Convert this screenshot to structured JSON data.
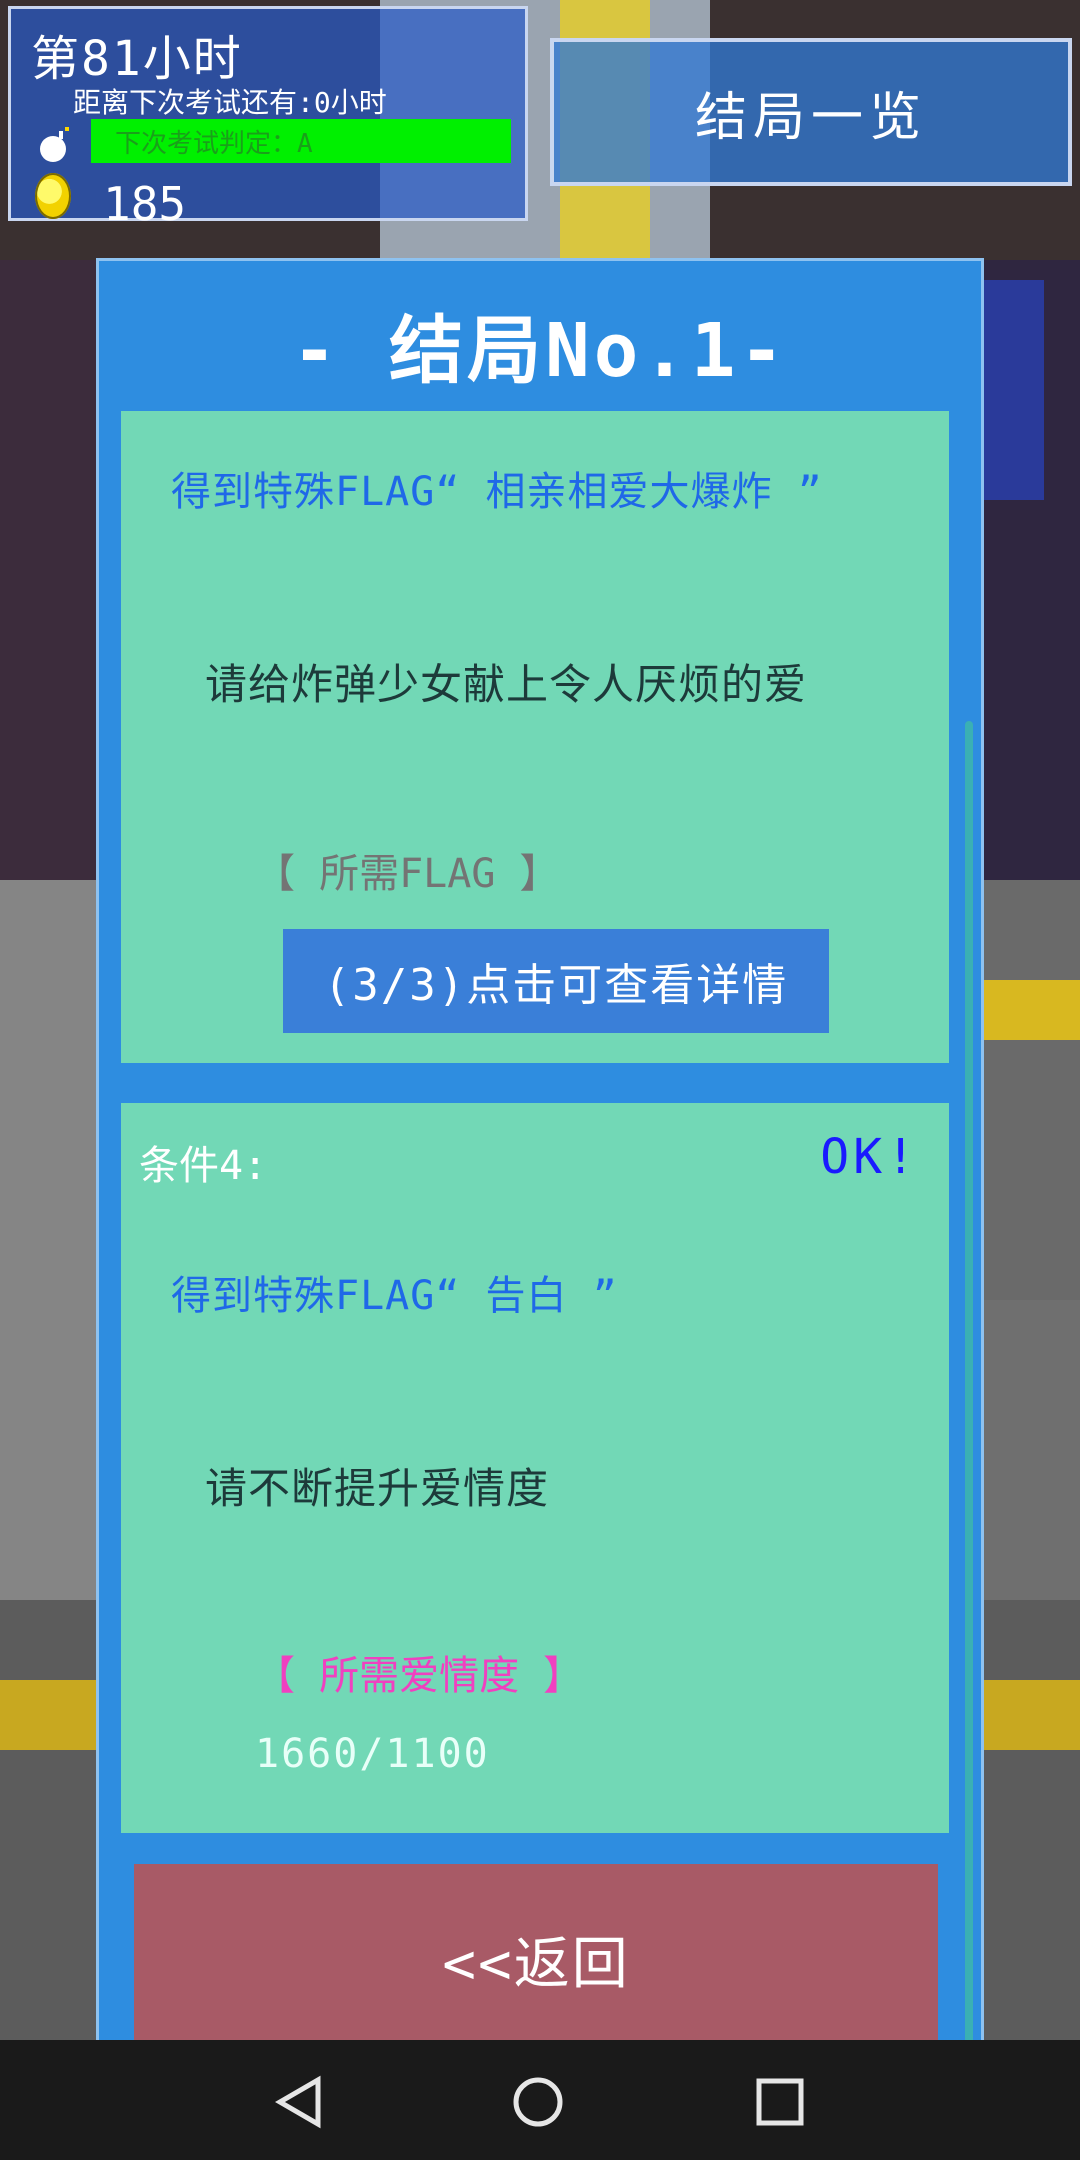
{
  "hud": {
    "hour_label": "第81小时",
    "countdown": "距离下次考试还有:0小时",
    "grade": "下次考试判定：A",
    "coins": "185"
  },
  "header_button": "结局一览",
  "panel": {
    "title": "- 结局No.1-",
    "card1": {
      "flag_title": "得到特殊FLAG“ 相亲相爱大爆炸 ”",
      "description": "请给炸弹少女献上令人厌烦的爱",
      "requirement_label": "【 所需FLAG 】",
      "detail_button": "(3/3)点击可查看详情"
    },
    "card2": {
      "condition_label": "条件4:",
      "status": "OK!",
      "flag_title": "得到特殊FLAG“ 告白 ”",
      "description": "请不断提升爱情度",
      "requirement_label": "【 所需爱情度 】",
      "progress": "1660/1100"
    }
  },
  "back_button": "<<返回",
  "navbar": {
    "back_icon": "triangle-back-icon",
    "home_icon": "circle-home-icon",
    "recents_icon": "square-recents-icon"
  }
}
